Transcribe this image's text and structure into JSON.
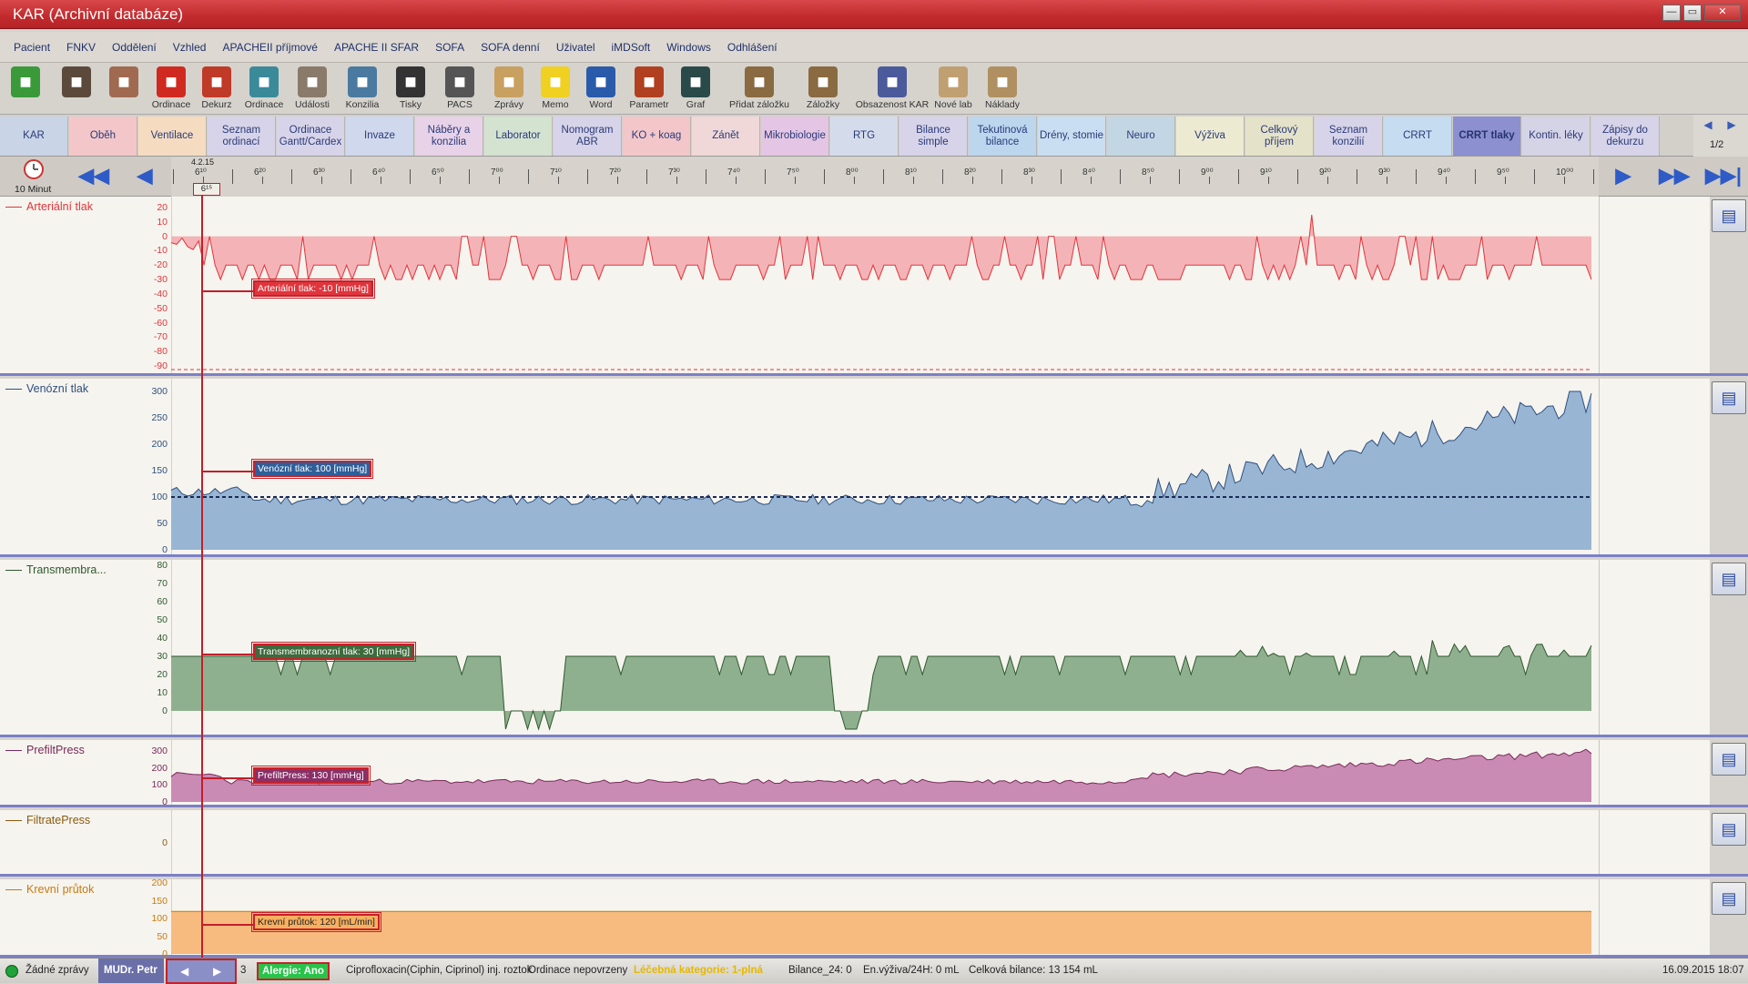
{
  "window": {
    "title": "KAR (Archivní databáze)",
    "controls": [
      "—",
      "▭",
      "✕"
    ]
  },
  "menu": [
    "Pacient",
    "FNKV",
    "Oddělení",
    "Vzhled",
    "APACHEII příjmové",
    "APACHE II SFAR",
    "SOFA",
    "SOFA denní",
    "Uživatel",
    "iMDSoft",
    "Windows",
    "Odhlášení"
  ],
  "toolbar": [
    {
      "label": "",
      "icon": "refresh-icon",
      "color": "#3a9a3a"
    },
    {
      "label": "",
      "icon": "doctor-avatar-icon",
      "color": "#5b4a3c"
    },
    {
      "label": "",
      "icon": "nurse-avatar-icon",
      "color": "#a06a50"
    },
    {
      "label": "Ordinace",
      "icon": "alarm-clock-icon",
      "color": "#d02a20"
    },
    {
      "label": "Dekurz",
      "icon": "binders-icon",
      "color": "#c03a28"
    },
    {
      "label": "Ordinace",
      "icon": "server-stack-icon",
      "color": "#3a8a9a"
    },
    {
      "label": "Události",
      "icon": "person-sitting-icon",
      "color": "#8a7a6a"
    },
    {
      "label": "Konzilia",
      "icon": "surgeon-icon",
      "color": "#4a7aa0"
    },
    {
      "label": "Tisky",
      "icon": "printer-icon",
      "color": "#333333"
    },
    {
      "label": "PACS",
      "icon": "xray-icon",
      "color": "#555555"
    },
    {
      "label": "Zprávy",
      "icon": "envelope-icon",
      "color": "#c8a060"
    },
    {
      "label": "Memo",
      "icon": "sticky-note-icon",
      "color": "#f0d020"
    },
    {
      "label": "Word",
      "icon": "word-icon",
      "color": "#2a5aaa"
    },
    {
      "label": "Parametr",
      "icon": "binoculars-icon",
      "color": "#b04020"
    },
    {
      "label": "Graf",
      "icon": "chart-screen-icon",
      "color": "#2a4a4a"
    },
    {
      "label": "Přidat záložku",
      "icon": "bookmark-add-icon",
      "color": "#8a6a40"
    },
    {
      "label": "Záložky",
      "icon": "bookmarks-icon",
      "color": "#8a6a40"
    },
    {
      "label": "Obsazenost KAR",
      "icon": "occupancy-icon",
      "color": "#4a5a9a"
    },
    {
      "label": "Nové lab",
      "icon": "lab-icon",
      "color": "#c0a070"
    },
    {
      "label": "Náklady",
      "icon": "money-bag-icon",
      "color": "#b09060"
    }
  ],
  "tabs": [
    {
      "label": "KAR",
      "color": "#c9d4e6"
    },
    {
      "label": "Oběh",
      "color": "#f3c7c9"
    },
    {
      "label": "Ventilace",
      "color": "#f5dcc0"
    },
    {
      "label": "Seznam ordinací",
      "color": "#d7d4e9"
    },
    {
      "label": "Ordinace Gantt/Cardex",
      "color": "#d7d4e9"
    },
    {
      "label": "Invaze",
      "color": "#cfd8ec"
    },
    {
      "label": "Náběry a konzilia",
      "color": "#e8d2e8"
    },
    {
      "label": "Laborator",
      "color": "#d4e2d0"
    },
    {
      "label": "Nomogram ABR",
      "color": "#d7d4e9"
    },
    {
      "label": "KO + koag",
      "color": "#f3c7c9"
    },
    {
      "label": "Zánět",
      "color": "#f0d8d8"
    },
    {
      "label": "Mikrobiologie",
      "color": "#e4c6e4"
    },
    {
      "label": "RTG",
      "color": "#d4dcec"
    },
    {
      "label": "Bilance simple",
      "color": "#d7d4e9"
    },
    {
      "label": "Tekutinová bilance",
      "color": "#bcd6ee"
    },
    {
      "label": "Drény, stomie",
      "color": "#c9def0"
    },
    {
      "label": "Neuro",
      "color": "#c2d7e3"
    },
    {
      "label": "Výživa",
      "color": "#ecead0"
    },
    {
      "label": "Celkový příjem",
      "color": "#e4e2c8"
    },
    {
      "label": "Seznam konzilií",
      "color": "#d7d4e9"
    },
    {
      "label": "CRRT",
      "color": "#c6dcf0"
    },
    {
      "label": "CRRT tlaky",
      "color": "#8c8fd0"
    },
    {
      "label": "Kontin. léky",
      "color": "#d5d3e6"
    },
    {
      "label": "Zápisy do dekurzu",
      "color": "#d7d4e9"
    }
  ],
  "tab_page": "1/2",
  "timenav": {
    "interval": "10 Minut",
    "date": "4.2.15",
    "cursor_time": "6¹⁵"
  },
  "ruler_labels": [
    "6¹⁰",
    "6²⁰",
    "6³⁰",
    "6⁴⁰",
    "6⁵⁰",
    "7⁰⁰",
    "7¹⁰",
    "7²⁰",
    "7³⁰",
    "7⁴⁰",
    "7⁵⁰",
    "8⁰⁰",
    "8¹⁰",
    "8²⁰",
    "8³⁰",
    "8⁴⁰",
    "8⁵⁰",
    "9⁰⁰",
    "9¹⁰",
    "9²⁰",
    "9³⁰",
    "9⁴⁰",
    "9⁵⁰",
    "10⁰⁰"
  ],
  "panels": [
    {
      "name": "Arteriální tlak",
      "color": "#e0353c",
      "fill": "#f4b3b7",
      "ticks": [
        "20",
        "10",
        "0",
        "-10",
        "-20",
        "-30",
        "-40",
        "-50",
        "-60",
        "-70",
        "-80",
        "-90"
      ],
      "tooltip": "Arteriální tlak: -10 [mmHg]",
      "tipbg": "#e0353c",
      "tipfg": "#ffffff"
    },
    {
      "name": "Venózní tlak",
      "color": "#2e4f7f",
      "fill": "#98b6d4",
      "ticks": [
        "300",
        "250",
        "200",
        "150",
        "100",
        "50",
        "0"
      ],
      "tooltip": "Venózní tlak: 100 [mmHg]",
      "tipbg": "#2e5f9a",
      "tipfg": "#ffffff"
    },
    {
      "name": "Transmembra...",
      "color": "#2e5a2e",
      "fill": "#8fb08f",
      "ticks": [
        "80",
        "70",
        "60",
        "50",
        "40",
        "30",
        "20",
        "10",
        "0"
      ],
      "tooltip": "Transmembranozní tlak: 30 [mmHg]",
      "tipbg": "#3d6b3d",
      "tipfg": "#ffffff"
    },
    {
      "name": "PrefiltPress",
      "color": "#7a2a5a",
      "fill": "#c98bb4",
      "ticks": [
        "300",
        "200",
        "100",
        "0"
      ],
      "tooltip": "PrefiltPress: 130 [mmHg]",
      "tipbg": "#8a3068",
      "tipfg": "#ffffff"
    },
    {
      "name": "FiltratePress",
      "color": "#8a5a10",
      "fill": "#f0c890",
      "ticks": [
        "0"
      ],
      "tooltip": "",
      "tipbg": "",
      "tipfg": ""
    },
    {
      "name": "Krevní průtok",
      "color": "#c87a10",
      "fill": "#f7bb80",
      "ticks": [
        "200",
        "150",
        "100",
        "50",
        "0"
      ],
      "tooltip": "Krevní průtok: 120 [mL/min]",
      "tipbg": "#f7b060",
      "tipfg": "#222222"
    }
  ],
  "status": {
    "messages": "Žádné zprávy",
    "user": "MUDr. Petr",
    "item_count": "3",
    "allergy": "Alergie: Ano",
    "drug": "Ciprofloxacin(Ciphin, Ciprinol) inj. roztok",
    "order": "Ordinace nepovrzeny",
    "category": "Léčebná kategorie: 1-plná",
    "balance24": "Bilance_24: 0",
    "nutrition": "En.výživa/24H: 0 mL",
    "total_balance": "Celková bilance: 13 154 mL",
    "datetime": "16.09.2015 18:07"
  }
}
